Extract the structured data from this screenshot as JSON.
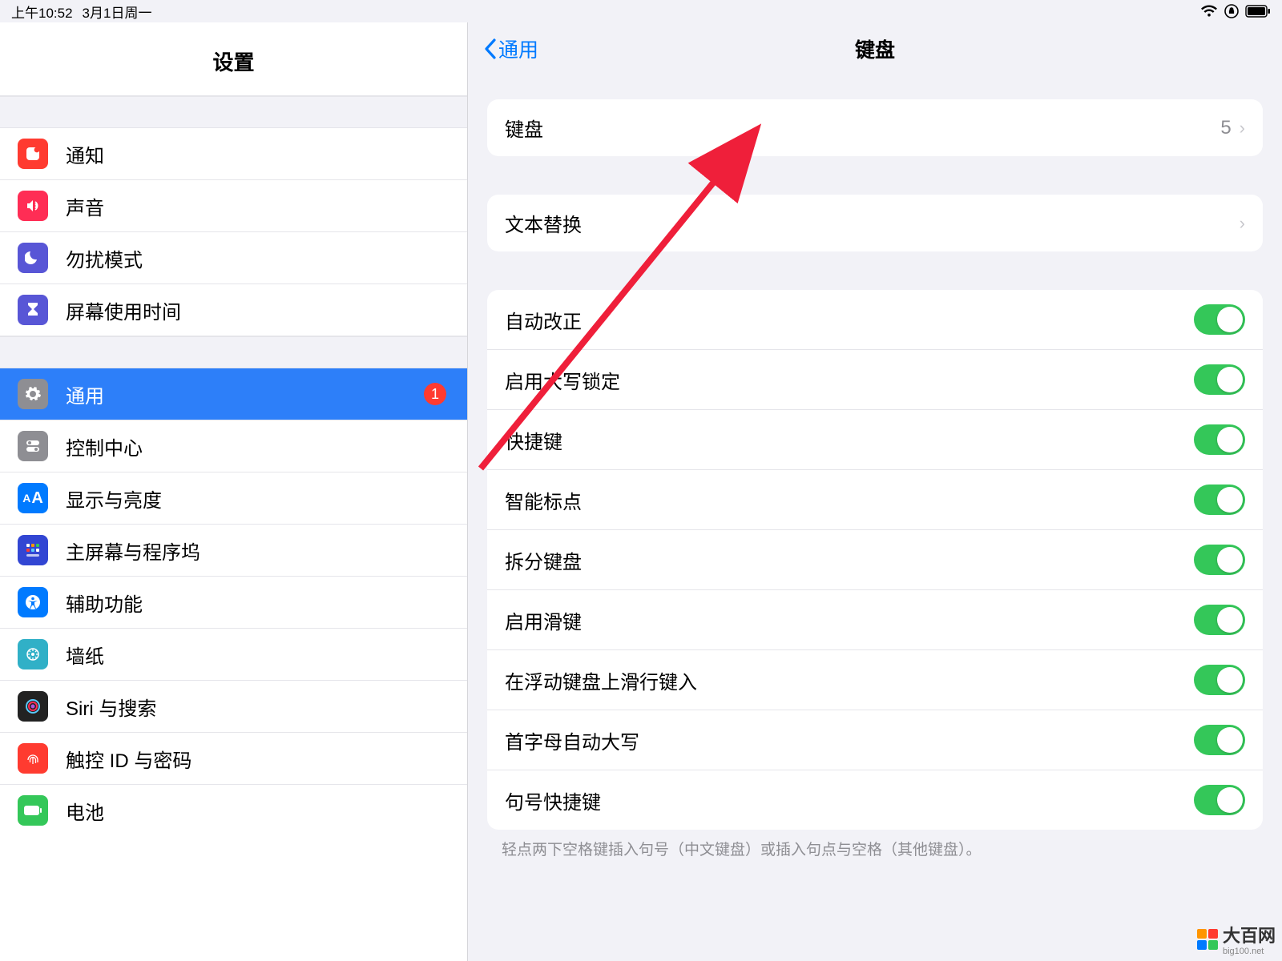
{
  "status": {
    "time": "上午10:52",
    "date": "3月1日周一"
  },
  "sidebar": {
    "title": "设置",
    "group1": [
      {
        "id": "notifications",
        "label": "通知",
        "color": "#ff3b30"
      },
      {
        "id": "sounds",
        "label": "声音",
        "color": "#ff2d55"
      },
      {
        "id": "dnd",
        "label": "勿扰模式",
        "color": "#5856d6"
      },
      {
        "id": "screentime",
        "label": "屏幕使用时间",
        "color": "#5856d6"
      }
    ],
    "group2": [
      {
        "id": "general",
        "label": "通用",
        "color": "#8e8e93",
        "selected": true,
        "badge": "1"
      },
      {
        "id": "control",
        "label": "控制中心",
        "color": "#8e8e93"
      },
      {
        "id": "display",
        "label": "显示与亮度",
        "color": "#007aff"
      },
      {
        "id": "home",
        "label": "主屏幕与程序坞",
        "color": "#3246d3"
      },
      {
        "id": "accessibility",
        "label": "辅助功能",
        "color": "#007aff"
      },
      {
        "id": "wallpaper",
        "label": "墙纸",
        "color": "#30b0c7"
      },
      {
        "id": "siri",
        "label": "Siri 与搜索",
        "color": "#222"
      },
      {
        "id": "touchid",
        "label": "触控 ID 与密码",
        "color": "#ff3b30"
      },
      {
        "id": "battery",
        "label": "电池",
        "color": "#34c759"
      }
    ]
  },
  "detail": {
    "back": "通用",
    "title": "键盘",
    "nav": {
      "keyboards_label": "键盘",
      "keyboards_value": "5",
      "textreplace": "文本替换"
    },
    "toggles": [
      {
        "label": "自动改正",
        "on": true
      },
      {
        "label": "启用大写锁定",
        "on": true
      },
      {
        "label": "快捷键",
        "on": true
      },
      {
        "label": "智能标点",
        "on": true
      },
      {
        "label": "拆分键盘",
        "on": true
      },
      {
        "label": "启用滑键",
        "on": true
      },
      {
        "label": "在浮动键盘上滑行键入",
        "on": true
      },
      {
        "label": "首字母自动大写",
        "on": true
      },
      {
        "label": "句号快捷键",
        "on": true
      }
    ],
    "footnote": "轻点两下空格键插入句号（中文键盘）或插入句点与空格（其他键盘）。"
  },
  "watermark": {
    "text": "大百网",
    "sub": "big100.net"
  }
}
